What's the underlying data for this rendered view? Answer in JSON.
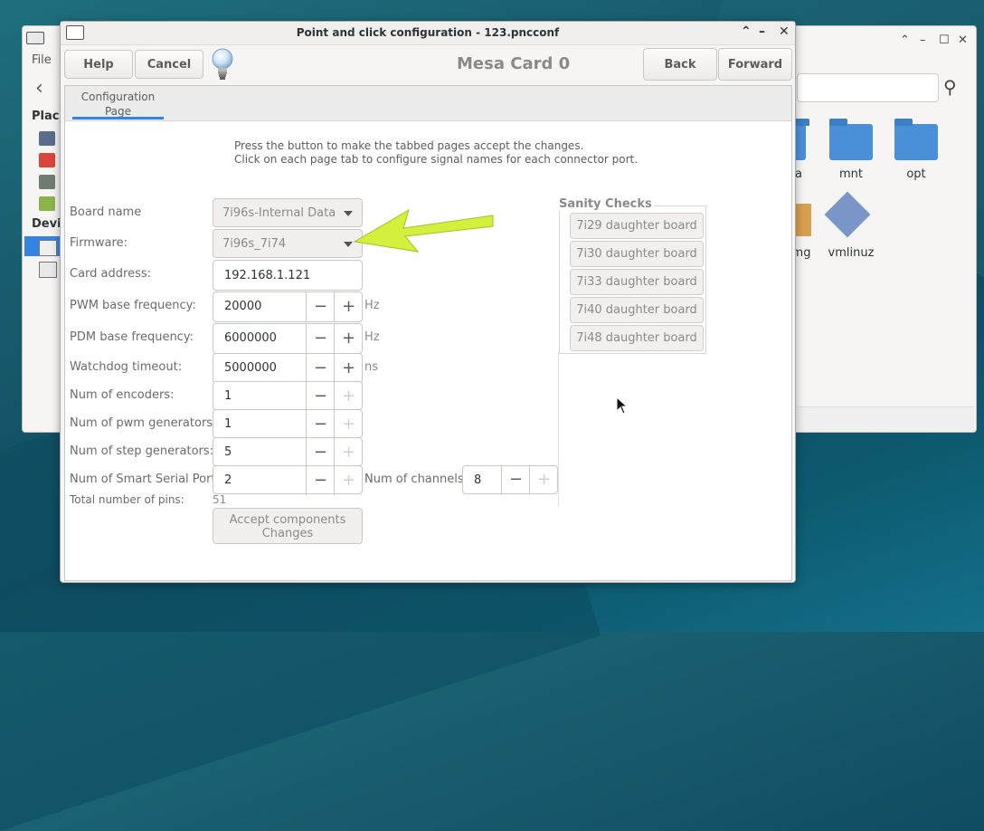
{
  "desktop": {
    "accent": "#3584e4"
  },
  "file_manager": {
    "menu_file": "File",
    "sidebar_places": "Place",
    "sidebar_devices": "Devi",
    "folders": [
      {
        "name": "a"
      },
      {
        "name": "mnt"
      },
      {
        "name": "opt"
      }
    ],
    "files": [
      {
        "name": "mg"
      },
      {
        "name": "vmlinuz"
      }
    ]
  },
  "dialog": {
    "title": "Point and click configuration - 123.pncconf",
    "buttons": {
      "help": "Help",
      "cancel": "Cancel",
      "back": "Back",
      "forward": "Forward"
    },
    "header_title": "Mesa Card 0",
    "tab": "Configuration Page",
    "instructions": [
      "Press the button to make the tabbed pages accept the changes.",
      "Click on each page tab to configure signal names for each connector port."
    ],
    "form": {
      "board_name_label": "Board name",
      "board_name_value": "7i96s-Internal Data",
      "firmware_label": "Firmware:",
      "firmware_value": "7i96s_7i74",
      "card_address_label": "Card address:",
      "card_address_value": "192.168.1.121",
      "pwm_freq_label": "PWM base frequency:",
      "pwm_freq_value": "20000",
      "pwm_freq_unit": "Hz",
      "pdm_freq_label": "PDM base frequency:",
      "pdm_freq_value": "6000000",
      "pdm_freq_unit": "Hz",
      "watchdog_label": "Watchdog timeout:",
      "watchdog_value": "5000000",
      "watchdog_unit": "ns",
      "encoders_label": "Num of encoders:",
      "encoders_value": "1",
      "pwm_gen_label": "Num of pwm generators:",
      "pwm_gen_value": "1",
      "step_gen_label": "Num of step generators:",
      "step_gen_value": "5",
      "sserial_label": "Num of Smart Serial Ports:",
      "sserial_value": "2",
      "channels_label": "Num of channels:",
      "channels_value": "8",
      "total_pins_label": "Total number of pins:",
      "total_pins_value": "51",
      "accept_line1": "Accept  components",
      "accept_line2": "Changes"
    },
    "sanity": {
      "title": "Sanity Checks",
      "buttons": [
        "7i29 daughter board",
        "7i30 daughter board",
        "7i33 daughter board",
        "7i40 daughter board",
        "7i48 daughter board"
      ]
    },
    "annotation_arrow_color": "#d4ef3c"
  }
}
